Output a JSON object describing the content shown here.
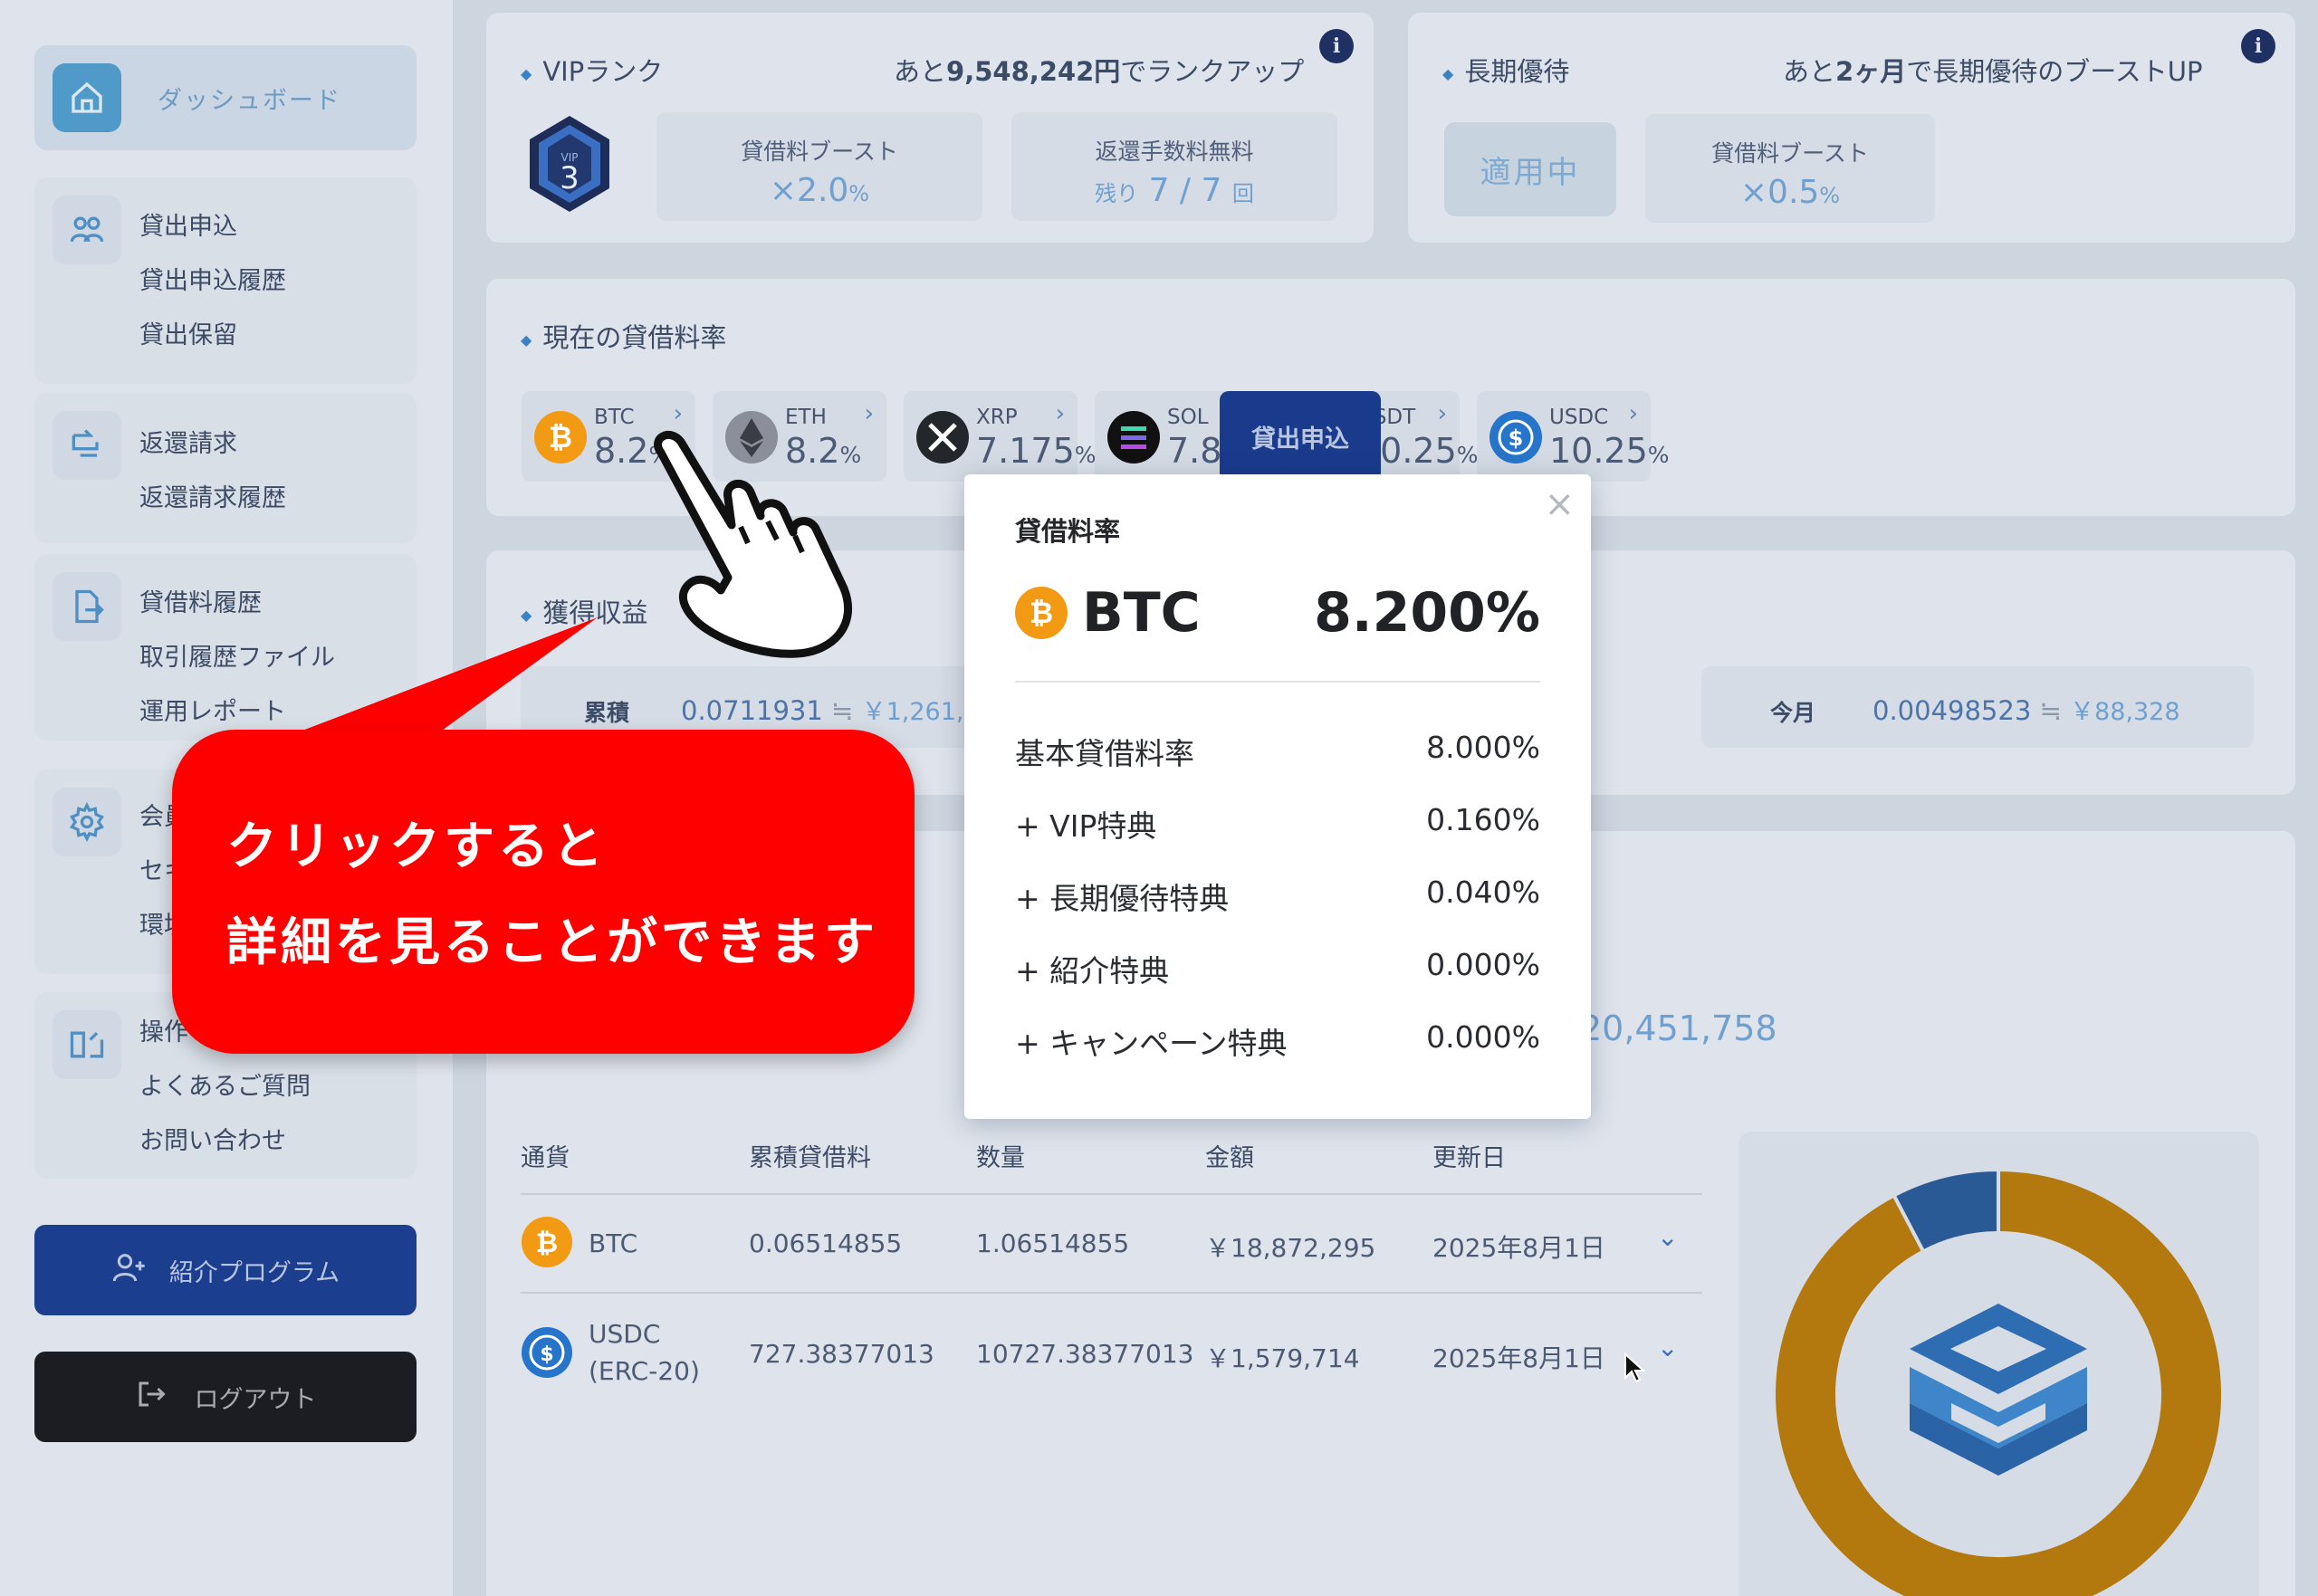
{
  "sidebar": {
    "dashboard": "ダッシュボード",
    "loan_group": [
      "貸出申込",
      "貸出申込履歴",
      "貸出保留"
    ],
    "return_group": [
      "返還請求",
      "返還請求履歴"
    ],
    "history_group": [
      "貸借料履歴",
      "取引履歴ファイル",
      "運用レポート"
    ],
    "member_group": [
      "会員",
      "セキ",
      "環境"
    ],
    "help_group": [
      "操作",
      "よくあるご質問",
      "お問い合わせ"
    ],
    "referral": "紹介プログラム",
    "logout": "ログアウト"
  },
  "vip": {
    "title": "VIPランク",
    "badge_label": "VIP",
    "badge_level": "3",
    "msg_pre": "あと",
    "msg_amount": "9,548,242円",
    "msg_post": "でランクアップ",
    "boost_title": "貸借料ブースト",
    "boost_value": "×2.0",
    "boost_unit": "%",
    "fee_title": "返還手数料無料",
    "fee_remaining_label": "残り",
    "fee_value": "7 / 7",
    "fee_unit": "回"
  },
  "long_term": {
    "title": "長期優待",
    "msg_pre": "あと",
    "msg_amount": "2ヶ月",
    "msg_post": "で長期優待のブーストUP",
    "applied": "適用中",
    "boost_title": "貸借料ブースト",
    "boost_value": "×0.5",
    "boost_unit": "%"
  },
  "rates": {
    "title": "現在の貸借料率",
    "coins": [
      {
        "name": "BTC",
        "rate": "8.2",
        "unit": "%",
        "color": "#f29a14"
      },
      {
        "name": "ETH",
        "rate": "8.2",
        "unit": "%",
        "color": "#8a8f99"
      },
      {
        "name": "XRP",
        "rate": "7.175",
        "unit": "%",
        "color": "#23262b"
      },
      {
        "name": "SOL",
        "rate": "7.875",
        "unit": "%",
        "color": "#111111"
      },
      {
        "name": "USDT",
        "rate": "10.25",
        "unit": "%",
        "color": "#26a17b"
      },
      {
        "name": "USDC",
        "rate": "10.25",
        "unit": "%",
        "color": "#2775ca"
      }
    ],
    "loan_button": "貸出申込"
  },
  "earnings": {
    "title": "獲得収益",
    "cumulative_label": "累積",
    "cumulative_value": "0.0711931",
    "cumulative_approx": "≒",
    "cumulative_jpy": "￥1,261,39",
    "month_label": "今月",
    "month_value": "0.00498523",
    "month_approx": "≒",
    "month_jpy": "￥88,328",
    "total_partial": "20,451,758"
  },
  "assets": {
    "headers": [
      "通貨",
      "累積貸借料",
      "数量",
      "金額",
      "更新日"
    ],
    "rows": [
      {
        "coin": "BTC",
        "coin_sub": "",
        "accrued": "0.06514855",
        "qty": "1.06514855",
        "amount": "￥18,872,295",
        "date": "2025年8月1日"
      },
      {
        "coin": "USDC",
        "coin_sub": "(ERC-20)",
        "accrued": "727.38377013",
        "qty": "10727.38377013",
        "amount": "￥1,579,714",
        "date": "2025年8月1日"
      }
    ]
  },
  "donut": {
    "slices": [
      {
        "label": "BTC",
        "fraction": 0.923,
        "color": "#b3790f"
      },
      {
        "label": "USDC",
        "fraction": 0.077,
        "color": "#2a5a96"
      }
    ]
  },
  "popup": {
    "title": "貸借料率",
    "coin": "BTC",
    "total": "8.200%",
    "rows": [
      {
        "label": "基本貸借料率",
        "value": "8.000%"
      },
      {
        "label": "+ VIP特典",
        "value": "0.160%"
      },
      {
        "label": "+ 長期優待特典",
        "value": "0.040%"
      },
      {
        "label": "+ 紹介特典",
        "value": "0.000%"
      },
      {
        "label": "+ キャンペーン特典",
        "value": "0.000%"
      }
    ]
  },
  "callout": {
    "line1": "クリックすると",
    "line2": "詳細を見ることができます"
  }
}
